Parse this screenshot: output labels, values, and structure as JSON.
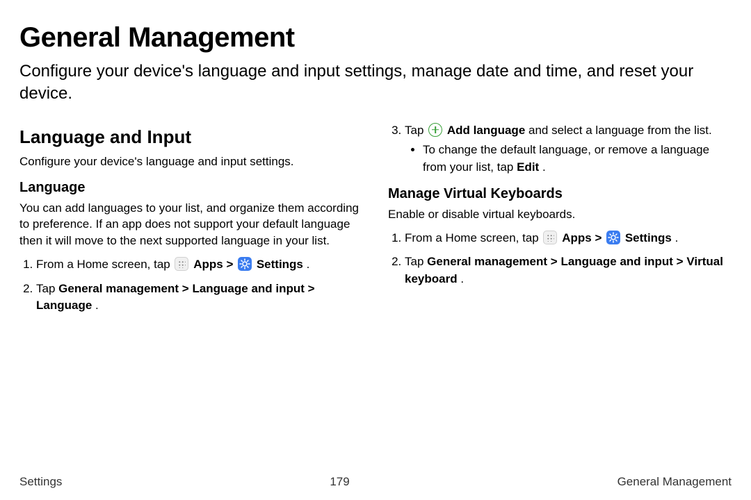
{
  "title": "General Management",
  "subtitle": "Configure your device's language and input settings, manage date and time, and reset your device.",
  "section_lang_input": {
    "heading": "Language and Input",
    "desc": "Configure your device's language and input settings."
  },
  "language": {
    "heading": "Language",
    "desc": "You can add languages to your list, and organize them according to preference. If an app does not support your default language then it will move to the next supported language in your list.",
    "step1_a": "From a Home screen, tap ",
    "apps_label": "Apps",
    "step1_b": " > ",
    "settings_label": "Settings",
    "step1_c": ".",
    "step2_a": "Tap ",
    "step2_b": "General management",
    "step2_gt1": " > ",
    "step2_c": "Language and input",
    "step2_gt2": " > ",
    "step2_d": "Language",
    "step2_e": "."
  },
  "language_r": {
    "step3_a": "Tap ",
    "add_lang": "Add language",
    "step3_b": " and select a language from the list.",
    "bullet_a": "To change the default language, or remove a language from your list, tap ",
    "bullet_edit": "Edit",
    "bullet_b": "."
  },
  "keyboards": {
    "heading": "Manage Virtual Keyboards",
    "desc": "Enable or disable virtual keyboards.",
    "step1_a": "From a Home screen, tap ",
    "apps_label": "Apps",
    "step1_b": " > ",
    "settings_label": "Settings",
    "step1_c": ".",
    "step2_a": "Tap ",
    "step2_b": "General management",
    "step2_gt1": " > ",
    "step2_c": "Language and input",
    "step2_gt2": " > ",
    "step2_d": "Virtual keyboard",
    "step2_e": "."
  },
  "footer": {
    "left": "Settings",
    "center": "179",
    "right": "General Management"
  }
}
